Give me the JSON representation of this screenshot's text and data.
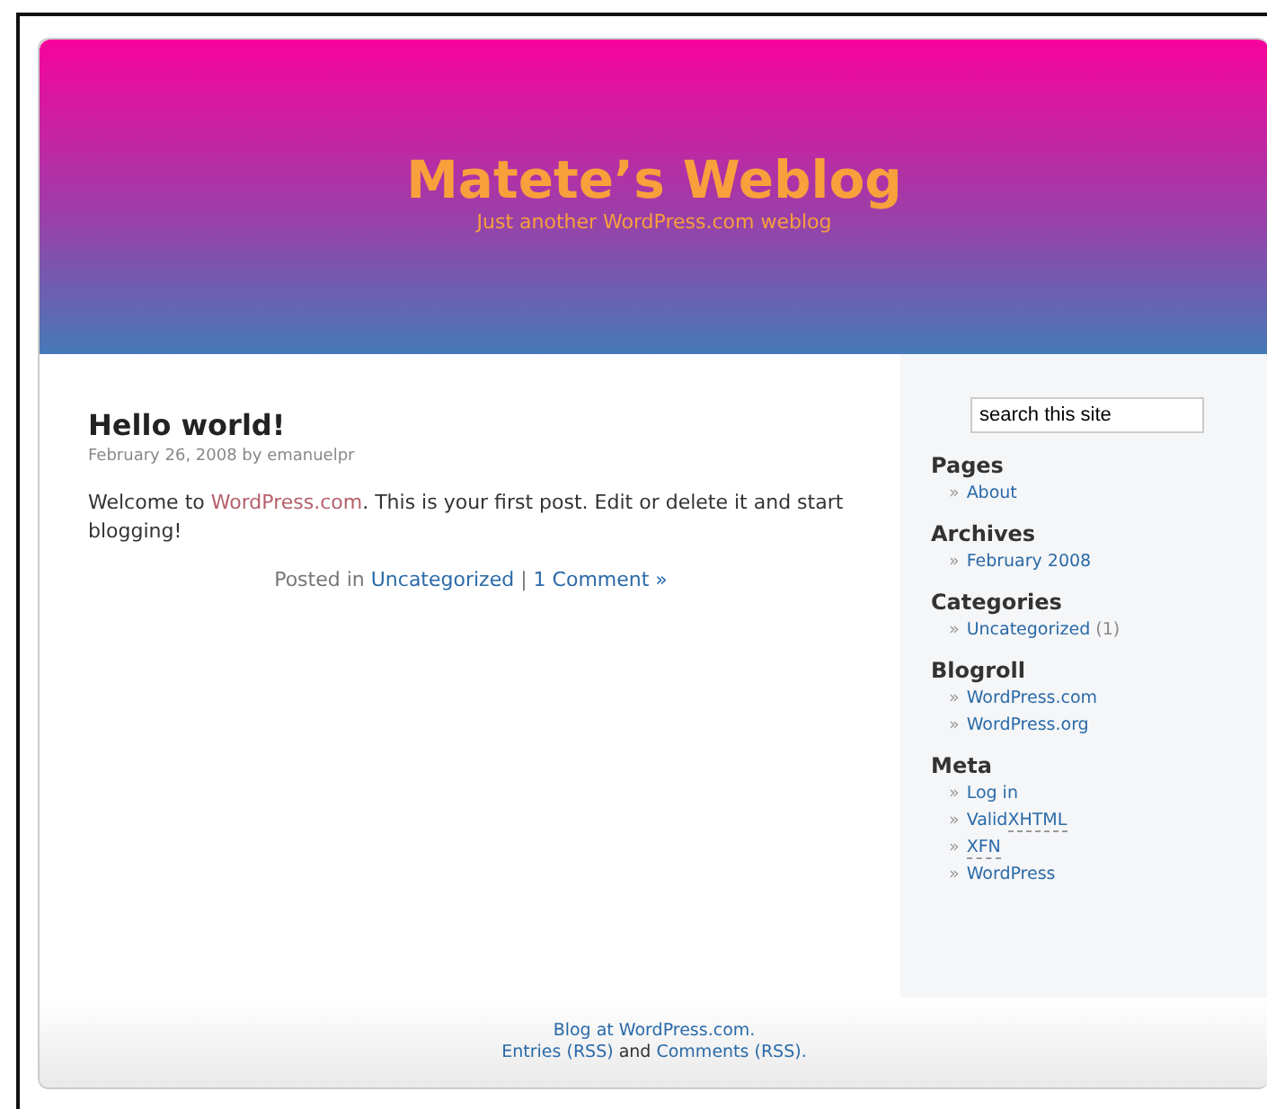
{
  "header": {
    "title": "Matete’s Weblog",
    "tagline": "Just another WordPress.com weblog"
  },
  "post": {
    "title": "Hello world!",
    "meta": "February 26, 2008 by emanuelpr",
    "body": [
      {
        "kind": "text",
        "text": "Welcome to "
      },
      {
        "kind": "link",
        "text": "WordPress.com"
      },
      {
        "kind": "text",
        "text": ". This is your first post. Edit or delete it and start blogging!"
      }
    ],
    "footer": [
      {
        "kind": "text",
        "text": "Posted in "
      },
      {
        "kind": "link",
        "text": "Uncategorized"
      },
      {
        "kind": "text",
        "text": " | "
      },
      {
        "kind": "link",
        "text": "1 Comment »"
      }
    ]
  },
  "sidebar": {
    "search": {
      "placeholder": "search this site"
    },
    "sections": [
      {
        "title": "Pages",
        "items": [
          {
            "bullet": "»",
            "label": "About"
          }
        ]
      },
      {
        "title": "Archives",
        "items": [
          {
            "bullet": "»",
            "label": "February 2008"
          }
        ]
      },
      {
        "title": "Categories",
        "items": [
          {
            "bullet": "»",
            "label": "Uncategorized",
            "count": "(1)"
          }
        ]
      },
      {
        "title": "Blogroll",
        "items": [
          {
            "bullet": "»",
            "label": "WordPress.com"
          },
          {
            "bullet": "»",
            "label": "WordPress.org"
          }
        ]
      },
      {
        "title": "Meta",
        "items": [
          {
            "bullet": "»",
            "label": "Log in"
          },
          {
            "bullet": "»",
            "label": "Valid",
            "abbr": "XHTML"
          },
          {
            "bullet": "»",
            "abbr": "XFN"
          },
          {
            "bullet": "»",
            "label": "WordPress"
          }
        ]
      }
    ]
  },
  "footer": {
    "lines": [
      [
        {
          "kind": "link",
          "text": "Blog at WordPress.com."
        }
      ],
      [
        {
          "kind": "link",
          "text": "Entries (RSS)"
        },
        {
          "kind": "text",
          "text": " and "
        },
        {
          "kind": "link",
          "text": "Comments (RSS)"
        },
        {
          "kind": "link",
          "text": "."
        }
      ]
    ]
  }
}
